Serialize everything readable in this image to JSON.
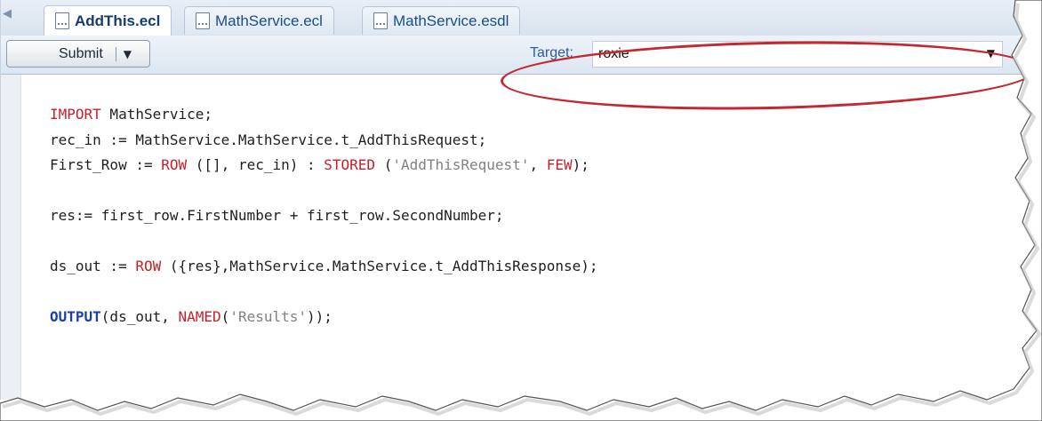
{
  "tabs": [
    {
      "label": "AddThis.ecl",
      "active": true
    },
    {
      "label": "MathService.ecl",
      "active": false
    },
    {
      "label": "MathService.esdl",
      "active": false
    }
  ],
  "toolbar": {
    "submit_label": "Submit",
    "target_label": "Target:",
    "target_value": "roxie"
  },
  "code_lines": [
    [
      {
        "t": "IMPORT",
        "c": "kw-red"
      },
      {
        "t": " MathService;"
      }
    ],
    [
      {
        "t": "rec_in := MathService.MathService.t_AddThisRequest;"
      }
    ],
    [
      {
        "t": "First_Row := "
      },
      {
        "t": "ROW",
        "c": "kw-red"
      },
      {
        "t": " ([], rec_in) : "
      },
      {
        "t": "STORED",
        "c": "kw-red"
      },
      {
        "t": " ("
      },
      {
        "t": "'AddThisRequest'",
        "c": "str"
      },
      {
        "t": ", "
      },
      {
        "t": "FEW",
        "c": "kw-red"
      },
      {
        "t": ");"
      }
    ],
    [],
    [
      {
        "t": "res:= first_row.FirstNumber + first_row.SecondNumber;"
      }
    ],
    [],
    [
      {
        "t": "ds_out := "
      },
      {
        "t": "ROW",
        "c": "kw-red"
      },
      {
        "t": " ({res},MathService.MathService.t_AddThisResponse);"
      }
    ],
    [],
    [
      {
        "t": "OUTPUT",
        "c": "kw-blue"
      },
      {
        "t": "(ds_out, "
      },
      {
        "t": "NAMED",
        "c": "kw-red"
      },
      {
        "t": "("
      },
      {
        "t": "'Results'",
        "c": "str"
      },
      {
        "t": "));"
      }
    ]
  ],
  "colors": {
    "keyword_red": "#c8202a",
    "keyword_blue": "#1a3fa8",
    "string_gray": "#808080",
    "tab_text": "#1a4e8a",
    "highlight_ellipse": "#c3272f"
  },
  "icons": {
    "tab_icon": "ecl-file-icon",
    "dropdown": "chevron-down-icon"
  }
}
